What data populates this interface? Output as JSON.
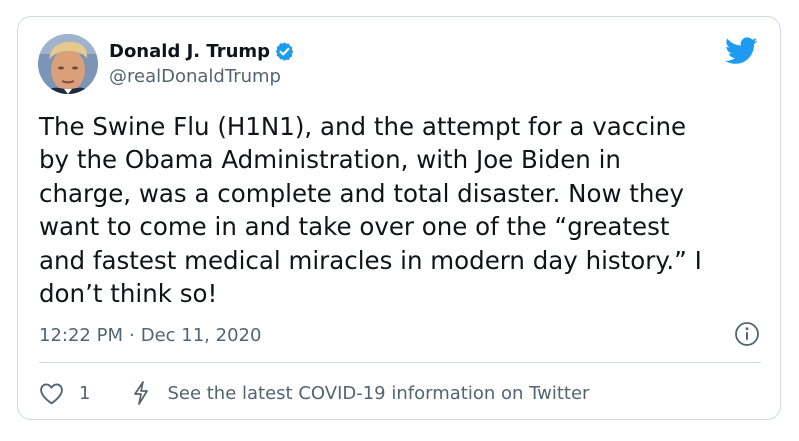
{
  "tweet": {
    "author": {
      "display_name": "Donald J. Trump",
      "handle": "@realDonaldTrump",
      "verified": true
    },
    "text": "The Swine Flu (H1N1), and the attempt for a vaccine\nby the Obama Administration, with Joe Biden in\ncharge, was a complete and total disaster. Now they\nwant to come in and take over one of the “greatest\nand fastest medical miracles in modern day history.” I\ndon’t think so!",
    "time": "12:22 PM",
    "separator": "·",
    "date": "Dec 11, 2020",
    "likes": "1",
    "covid_link": "See the latest COVID-19 information on Twitter"
  },
  "icons": {
    "brand": "twitter-bird-icon",
    "verified": "verified-badge-icon",
    "info": "info-icon",
    "like": "heart-icon",
    "covid": "lightning-bolt-icon"
  },
  "colors": {
    "brand_blue": "#1d9bf0",
    "text_primary": "#0f1419",
    "text_secondary": "#536471",
    "border": "#cfd9de"
  }
}
